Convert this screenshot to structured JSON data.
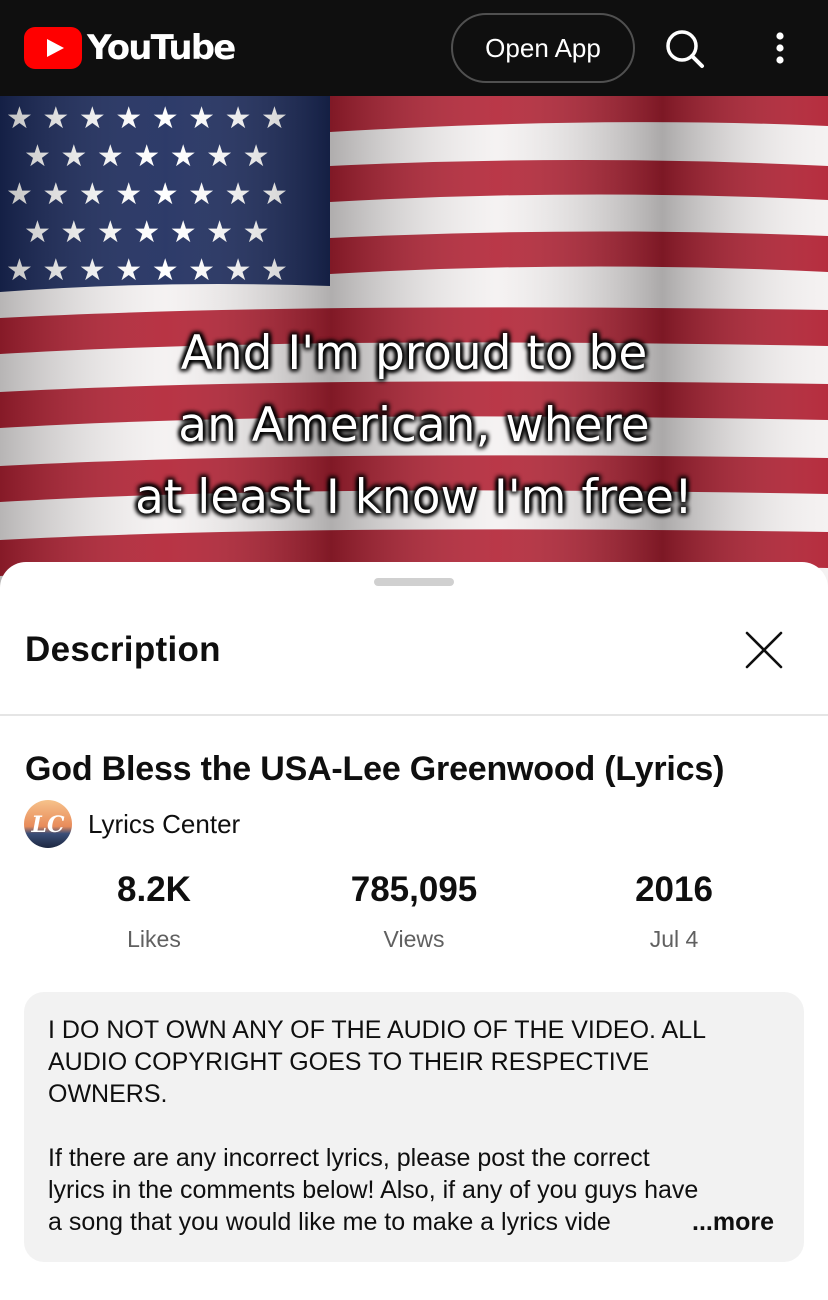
{
  "topbar": {
    "logo_text": "YouTube",
    "open_app_label": "Open App",
    "search_icon": "search-icon",
    "more_icon": "more-vertical-icon"
  },
  "hero": {
    "lyrics_lines": [
      "And I'm proud to be",
      "an American, where",
      "at least I know I'm free!"
    ]
  },
  "sheet": {
    "title": "Description",
    "close_icon": "close-icon"
  },
  "video": {
    "title": "God Bless the USA-Lee Greenwood (Lyrics)",
    "channel_name": "Lyrics Center",
    "stats": [
      {
        "value": "8.2K",
        "label": "Likes"
      },
      {
        "value": "785,095",
        "label": "Views"
      },
      {
        "value": "2016",
        "label": "Jul 4"
      }
    ]
  },
  "description": {
    "para1": [
      "I DO NOT OWN ANY OF THE AUDIO OF THE VIDEO. ALL",
      "AUDIO COPYRIGHT GOES TO THEIR RESPECTIVE",
      "OWNERS."
    ],
    "para2": [
      "If there are any incorrect lyrics, please post the correct",
      "lyrics in the comments below! Also, if any of you guys have",
      "a song that you would like me to make a lyrics vide"
    ],
    "more_label": "...more"
  },
  "colors": {
    "brand_red": "#ff0000",
    "topbar_bg": "#0f0f0f",
    "flag_red": "#b22234",
    "flag_blue": "#1b2a5c",
    "description_bg": "#f2f2f2"
  }
}
